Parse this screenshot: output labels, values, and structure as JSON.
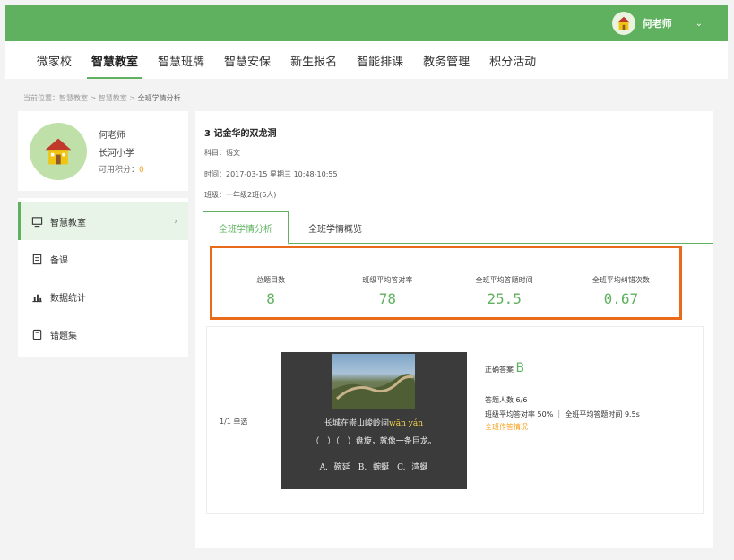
{
  "header": {
    "user_name": "何老师",
    "colors": {
      "bar": "#5fb15f",
      "accent": "#5fb15f",
      "highlight": "#e86a1a",
      "points": "#f39b12"
    }
  },
  "nav": {
    "items": [
      {
        "label": "微家校"
      },
      {
        "label": "智慧教室"
      },
      {
        "label": "智慧班牌"
      },
      {
        "label": "智慧安保"
      },
      {
        "label": "新生报名"
      },
      {
        "label": "智能排课"
      },
      {
        "label": "教务管理"
      },
      {
        "label": "积分活动"
      }
    ]
  },
  "breadcrumb": {
    "prefix": "当前位置：",
    "l1": "智慧教室",
    "l2": "智慧教室",
    "current": "全班学情分析"
  },
  "profile": {
    "name": "何老师",
    "school": "长河小学",
    "points_label": "可用积分：",
    "points_value": "0"
  },
  "sidebar": {
    "items": [
      {
        "label": "智慧教室",
        "icon": "classroom-icon"
      },
      {
        "label": "备课",
        "icon": "lesson-prep-icon"
      },
      {
        "label": "数据统计",
        "icon": "bar-chart-icon"
      },
      {
        "label": "错题集",
        "icon": "error-book-icon"
      }
    ]
  },
  "lesson": {
    "title": "3 记金华的双龙洞",
    "subject": "科目：语文",
    "time": "时间：2017-03-15 星期三 10:48-10:55",
    "class": "班级：一年级2班(6人)"
  },
  "tabs": [
    {
      "label": "全班学情分析"
    },
    {
      "label": "全班学情概览"
    }
  ],
  "stats": [
    {
      "label": "总题目数",
      "value": "8"
    },
    {
      "label": "班级平均答对率",
      "value": "78"
    },
    {
      "label": "全班平均答题时间",
      "value": "25.5"
    },
    {
      "label": "全班平均纠错次数",
      "value": "0.67"
    }
  ],
  "question": {
    "type": "1/1 单选",
    "slide_line1_text": "长城在崇山峻岭间",
    "slide_pinyin": "wān yán",
    "slide_line2": "（　）（　）盘旋，就像一条巨龙。",
    "slide_options": "A. 碗延　B. 蜿蜒　C. 湾蜒",
    "answer_label": "正确答案",
    "answer_letter": "B",
    "count": "答题人数 6/6",
    "rates": "班级平均答对率 50% ｜ 全班平均答题时间 9.5s",
    "detail_link": "全班作答情况"
  }
}
